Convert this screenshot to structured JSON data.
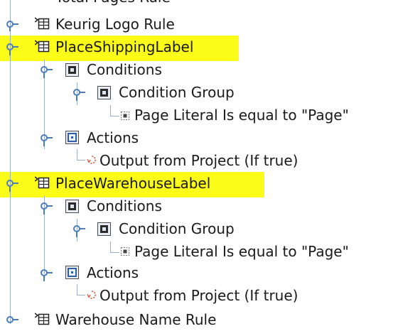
{
  "tree": {
    "items": [
      {
        "label": "Total Pages Rule"
      },
      {
        "label": "Keurig Logo Rule"
      },
      {
        "label": "PlaceShippingLabel"
      },
      {
        "label": "Conditions"
      },
      {
        "label": "Condition Group"
      },
      {
        "label": "Page Literal Is equal to \"Page\""
      },
      {
        "label": "Actions"
      },
      {
        "label": "Output from Project (If true)"
      },
      {
        "label": "PlaceWarehouseLabel"
      },
      {
        "label": "Conditions"
      },
      {
        "label": "Condition Group"
      },
      {
        "label": "Page Literal Is equal to \"Page\""
      },
      {
        "label": "Actions"
      },
      {
        "label": "Output from Project (If true)"
      },
      {
        "label": "Warehouse Name Rule"
      }
    ]
  },
  "colors": {
    "highlight": "#fcfc19",
    "tree_line": "#9bb0c8",
    "handle": "#4a7cc0",
    "text": "#1a1a1a"
  }
}
